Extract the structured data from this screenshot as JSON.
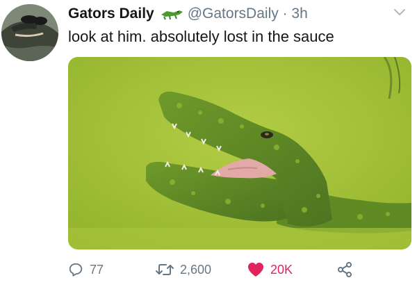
{
  "tweet": {
    "author_name": "Gators Daily",
    "author_handle": "@GatorsDaily · 3h",
    "text": "look at him. absolutely lost in the sauce",
    "avatar_icon": "alligator-with-sunglasses-avatar",
    "name_emoji_icon": "crocodile-emoji-icon",
    "menu_icon": "chevron-down-icon",
    "media_description_icon": "alligator-photo"
  },
  "actions": {
    "reply_count": "77",
    "retweet_count": "2,600",
    "like_count": "20K",
    "reply_icon": "reply-icon",
    "retweet_icon": "retweet-icon",
    "like_icon": "heart-icon",
    "share_icon": "share-icon",
    "liked": true
  },
  "colors": {
    "text_primary": "#14171a",
    "text_secondary": "#657786",
    "like_active": "#e0245e",
    "duckweed_green": "#a6c43a"
  }
}
